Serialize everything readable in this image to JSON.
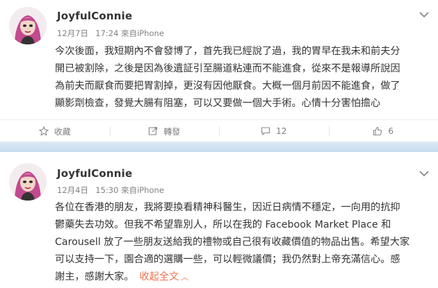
{
  "posts": [
    {
      "username": "JoyfulConnie",
      "date": "12月7日",
      "time": "17:24",
      "source": "來自iPhone",
      "lines": [
        "今次後面，我短期內不會發博了，首先我已經說了過，我的胃早在我未和前夫分",
        "開已被割除，之後是因為後遺証引至腸道粘連而不能進食，從來不是報導所說因",
        "為前夫而厭食而要把胃割掉，更沒有因他厭食。大概一個月前因不能進食，做了",
        "顯影劑檢查，發覺大腸有阻塞，可以又要做一個大手術。心情十分害怕擔心"
      ],
      "actions": {
        "favorite": "收藏",
        "repost": "轉發",
        "comment": "12",
        "like": "6"
      }
    },
    {
      "username": "JoyfulConnie",
      "date": "12月4日",
      "time": "15:30",
      "source": "來自iPhone",
      "lines": [
        "各位在香港的朋友，我將要換看精神科醫生，因近日病情不穩定，一向用的抗抑",
        "鬱藥失去功效。但我不希望靠別人，所以在我的 Facebook Market Place 和",
        "Carousell 放了一些朋友送給我的禮物或自己很有收藏價值的物品出售。希望大家",
        "可以支持一下，園合適的選購一些，可以輕微議價；我仍然對上帝充滿信心。感"
      ],
      "last_line": "謝主，感謝大家。",
      "expand_label": "收起全文",
      "expand_arrow": "︿"
    }
  ]
}
